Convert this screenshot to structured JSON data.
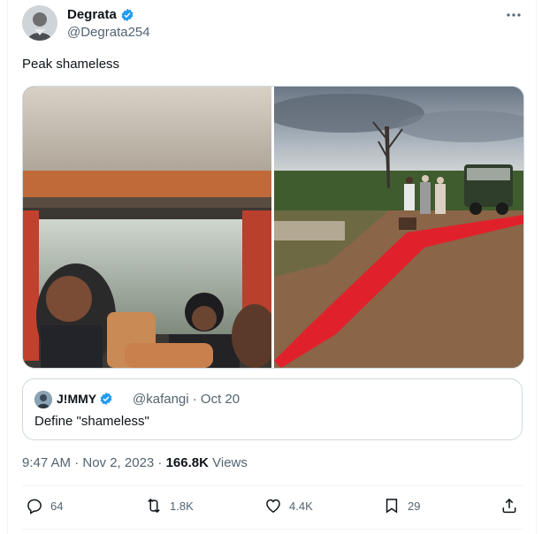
{
  "author": {
    "name": "Degrata",
    "handle": "@Degrata254"
  },
  "tweet": {
    "text": "Peak shameless"
  },
  "quote": {
    "name": "J!MMY",
    "meta": "@kafangi · Oct 20",
    "text": "Define \"shameless\""
  },
  "meta": {
    "time": "9:47 AM · Nov 2, 2023 · ",
    "views_count": "166.8K",
    "views_label": " Views"
  },
  "actions": {
    "replies": "64",
    "retweets": "1.8K",
    "likes": "4.4K",
    "bookmarks": "29"
  },
  "colors": {
    "verified": "#1d9bf0",
    "carpet": "#e0212b",
    "muted": "#536471"
  },
  "icons": [
    "more-icon",
    "verified-icon",
    "reply-icon",
    "retweet-icon",
    "like-icon",
    "bookmark-icon",
    "share-icon"
  ]
}
